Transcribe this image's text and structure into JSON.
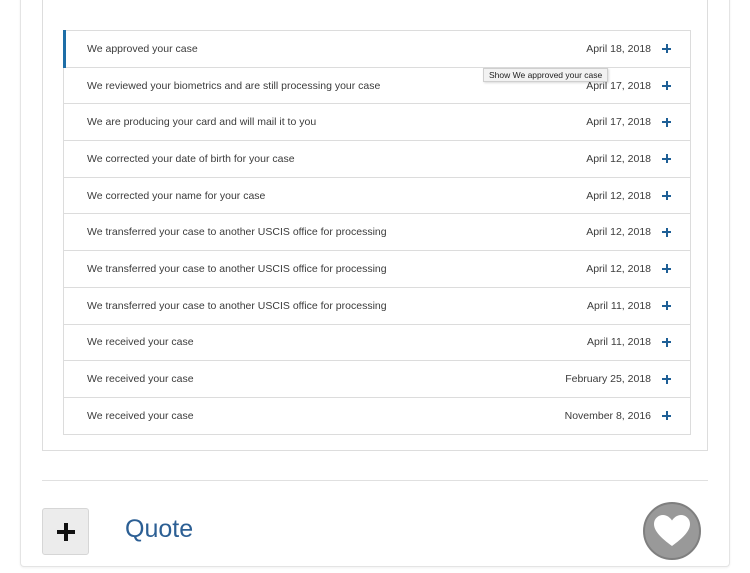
{
  "case_history": {
    "rows": [
      {
        "label": "We approved your case",
        "date": "April 18, 2018"
      },
      {
        "label": "We reviewed your biometrics and are still processing your case",
        "date": "April 17, 2018"
      },
      {
        "label": "We are producing your card and will mail it to you",
        "date": "April 17, 2018"
      },
      {
        "label": "We corrected your date of birth for your case",
        "date": "April 12, 2018"
      },
      {
        "label": "We corrected your name for your case",
        "date": "April 12, 2018"
      },
      {
        "label": "We transferred your case to another USCIS office for processing",
        "date": "April 12, 2018"
      },
      {
        "label": "We transferred your case to another USCIS office for processing",
        "date": "April 12, 2018"
      },
      {
        "label": "We transferred your case to another USCIS office for processing",
        "date": "April 11, 2018"
      },
      {
        "label": "We received your case",
        "date": "April 11, 2018"
      },
      {
        "label": "We received your case",
        "date": "February 25, 2018"
      },
      {
        "label": "We received your case",
        "date": "November 8, 2016"
      }
    ],
    "tooltip": "Show We approved your case"
  },
  "footer": {
    "quote_label": "Quote"
  },
  "icons": {
    "expand": "plus-icon",
    "add": "plus-icon",
    "like": "heart-icon"
  },
  "colors": {
    "accent": "#1e6ea7",
    "link": "#2c5f94",
    "heart_bg": "#999999"
  }
}
